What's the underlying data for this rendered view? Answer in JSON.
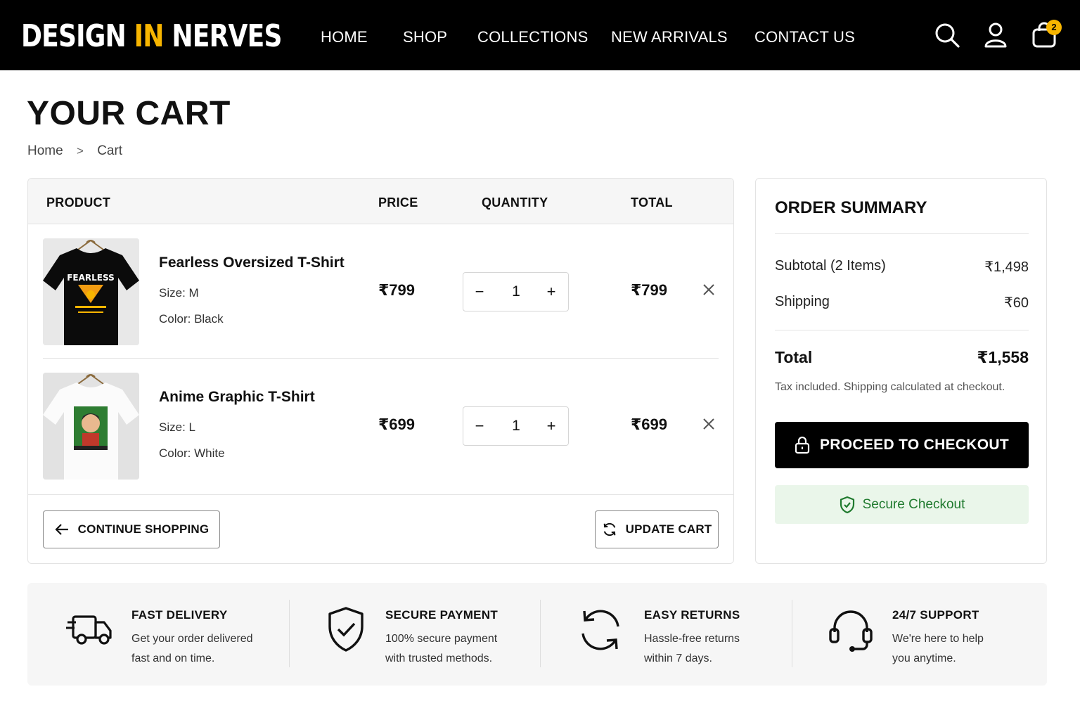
{
  "brand": {
    "part1": "DESIGN",
    "part2": "IN",
    "part3": "NERVES",
    "accent_color": "#f7b500"
  },
  "nav": {
    "items": [
      {
        "label": "HOME"
      },
      {
        "label": "SHOP"
      },
      {
        "label": "COLLECTIONS"
      },
      {
        "label": "NEW ARRIVALS"
      },
      {
        "label": "CONTACT US"
      }
    ]
  },
  "header_icons": [
    "search-icon",
    "user-icon",
    "shopping-bag-icon"
  ],
  "cart_count": "2",
  "page": {
    "title": "YOUR CART"
  },
  "breadcrumb": {
    "home": "Home",
    "separator": ">",
    "current": "Cart"
  },
  "table": {
    "headers": {
      "product": "PRODUCT",
      "price": "PRICE",
      "quantity": "QUANTITY",
      "total": "TOTAL"
    },
    "items": [
      {
        "name": "Fearless Oversized T-Shirt",
        "size": "Size: M",
        "color": "Color: Black",
        "price": "₹799",
        "quantity": "1",
        "total": "₹799",
        "image_text": "FEARLESS",
        "shirt_color": "#000000"
      },
      {
        "name": "Anime Graphic T-Shirt",
        "size": "Size: L",
        "color": "Color: White",
        "price": "₹699",
        "quantity": "1",
        "total": "₹699",
        "shirt_color": "#ffffff"
      }
    ],
    "qty_minus": "−",
    "qty_plus": "+"
  },
  "actions": {
    "continue": "CONTINUE SHOPPING",
    "update": "UPDATE CART"
  },
  "summary": {
    "title": "ORDER SUMMARY",
    "subtotal_label": "Subtotal (2 Items)",
    "subtotal_value": "₹1,498",
    "shipping_label": "Shipping",
    "shipping_value": "₹60",
    "total_label": "Total",
    "total_value": "₹1,558",
    "tax_note": "Tax included. Shipping calculated at checkout.",
    "checkout_label": "PROCEED TO CHECKOUT",
    "secure_label": "Secure Checkout",
    "secure_color": "#1f7a2e"
  },
  "features": [
    {
      "icon": "truck-icon",
      "title": "FAST DELIVERY",
      "line1": "Get your order delivered",
      "line2": "fast and on time."
    },
    {
      "icon": "shield-check-icon",
      "title": "SECURE PAYMENT",
      "line1": "100% secure payment",
      "line2": "with trusted methods."
    },
    {
      "icon": "refresh-icon",
      "title": "EASY RETURNS",
      "line1": "Hassle-free returns",
      "line2": "within 7 days."
    },
    {
      "icon": "headset-icon",
      "title": "24/7 SUPPORT",
      "line1": "We're here to help",
      "line2": "you anytime."
    }
  ]
}
